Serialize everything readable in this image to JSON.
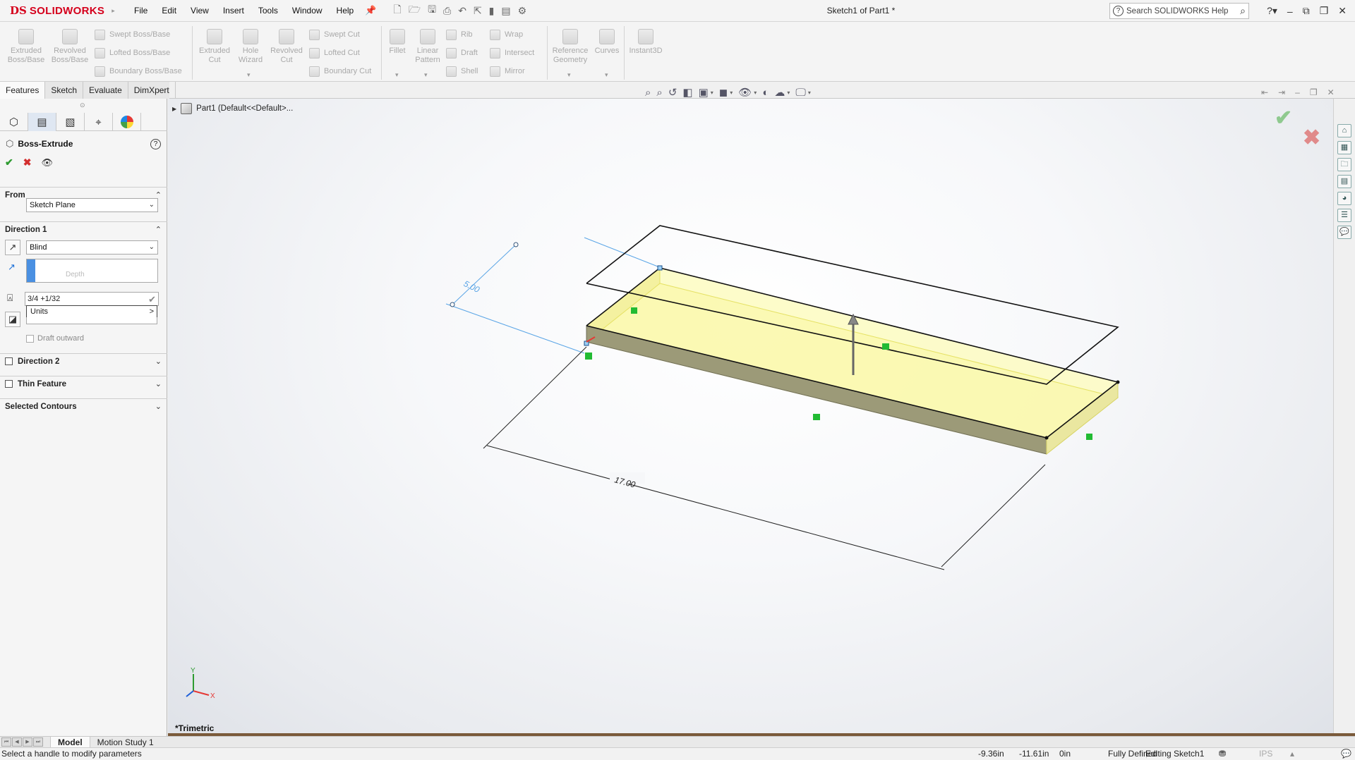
{
  "app": {
    "brand_prefix": "DS",
    "brand_name": "SOLIDWORKS",
    "document_title": "Sketch1 of Part1 *",
    "search_placeholder": "Search SOLIDWORKS Help",
    "menu": [
      "File",
      "Edit",
      "View",
      "Insert",
      "Tools",
      "Window",
      "Help"
    ]
  },
  "ribbon": {
    "extruded_boss": "Extruded Boss/Base",
    "revolved_boss": "Revolved Boss/Base",
    "swept_boss": "Swept Boss/Base",
    "lofted_boss": "Lofted Boss/Base",
    "boundary_boss": "Boundary Boss/Base",
    "extruded_cut": "Extruded Cut",
    "hole_wizard": "Hole Wizard",
    "revolved_cut": "Revolved Cut",
    "swept_cut": "Swept Cut",
    "lofted_cut": "Lofted Cut",
    "boundary_cut": "Boundary Cut",
    "fillet": "Fillet",
    "linear_pattern": "Linear Pattern",
    "rib": "Rib",
    "draft": "Draft",
    "shell": "Shell",
    "wrap": "Wrap",
    "intersect": "Intersect",
    "mirror": "Mirror",
    "reference_geometry": "Reference Geometry",
    "curves": "Curves",
    "instant3d": "Instant3D"
  },
  "cm_tabs": [
    "Features",
    "Sketch",
    "Evaluate",
    "DimXpert"
  ],
  "property_manager": {
    "title": "Boss-Extrude",
    "help": "?",
    "from_label": "From",
    "from_value": "Sketch Plane",
    "direction1_label": "Direction 1",
    "end_condition": "Blind",
    "depth_placeholder": "Depth",
    "depth_input": "3/4 +1/32",
    "units_popup": "Units",
    "units_arrow": ">",
    "draft_outward": "Draft outward",
    "direction2_label": "Direction 2",
    "thin_feature_label": "Thin Feature",
    "selected_contours_label": "Selected Contours"
  },
  "tree": {
    "root": "Part1  (Default<<Default>..."
  },
  "viewport": {
    "dim_width": "5.00",
    "dim_length": "17.00",
    "view_orientation": "*Trimetric",
    "triad_x": "X",
    "triad_y": "Y"
  },
  "bottom_tabs": [
    "Model",
    "Motion Study 1"
  ],
  "status": {
    "message": "Select a handle to modify parameters",
    "x": "-9.36in",
    "y": "-11.61in",
    "z": "0in",
    "definition": "Fully Defined",
    "editing": "Editing Sketch1",
    "units": "IPS"
  },
  "colors": {
    "brand_red": "#d5001c",
    "face_yellow": "#ffffc8",
    "dim_blue": "#5aa5e6",
    "ok_green": "#2e9b31",
    "cancel_red": "#d32f2f"
  }
}
